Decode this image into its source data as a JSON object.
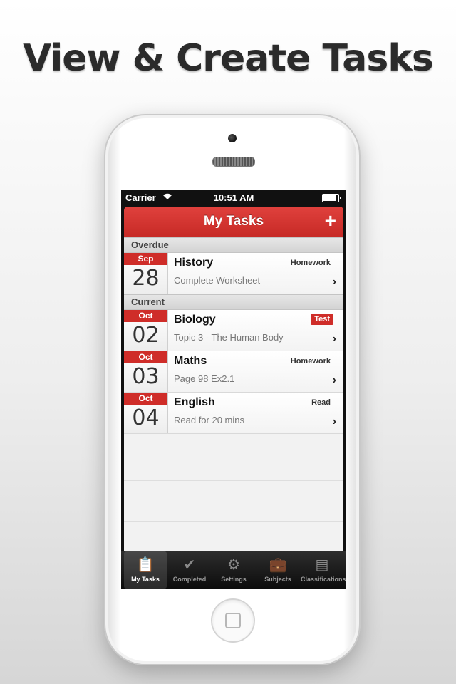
{
  "headline": "View & Create Tasks",
  "status_bar": {
    "carrier": "Carrier",
    "time": "10:51 AM",
    "battery_level": 0.85
  },
  "nav": {
    "title": "My Tasks",
    "add_label": "+"
  },
  "sections": [
    {
      "label": "Overdue"
    },
    {
      "label": "Current"
    }
  ],
  "tasks": [
    {
      "month": "Sep",
      "day": "28",
      "subject": "History",
      "type": "Homework",
      "description": "Complete Worksheet",
      "chevron": "›"
    },
    {
      "month": "Oct",
      "day": "02",
      "subject": "Biology",
      "type": "Test",
      "description": "Topic 3 - The Human Body",
      "chevron": "›"
    },
    {
      "month": "Oct",
      "day": "03",
      "subject": "Maths",
      "type": "Homework",
      "description": "Page 98 Ex2.1",
      "chevron": "›"
    },
    {
      "month": "Oct",
      "day": "04",
      "subject": "English",
      "type": "Read",
      "description": "Read for 20 mins",
      "chevron": "›"
    }
  ],
  "tabs": [
    {
      "label": "My Tasks",
      "icon": "clipboard-icon",
      "glyph": "📋",
      "active": true
    },
    {
      "label": "Completed",
      "icon": "checkmark-icon",
      "glyph": "✔",
      "active": false
    },
    {
      "label": "Settings",
      "icon": "gear-icon",
      "glyph": "⚙",
      "active": false
    },
    {
      "label": "Subjects",
      "icon": "briefcase-icon",
      "glyph": "💼",
      "active": false
    },
    {
      "label": "Classifications",
      "icon": "folder-stack-icon",
      "glyph": "▤",
      "active": false
    }
  ],
  "colors": {
    "accent": "#cf2d29",
    "tabbar": "#1a1a1a"
  }
}
